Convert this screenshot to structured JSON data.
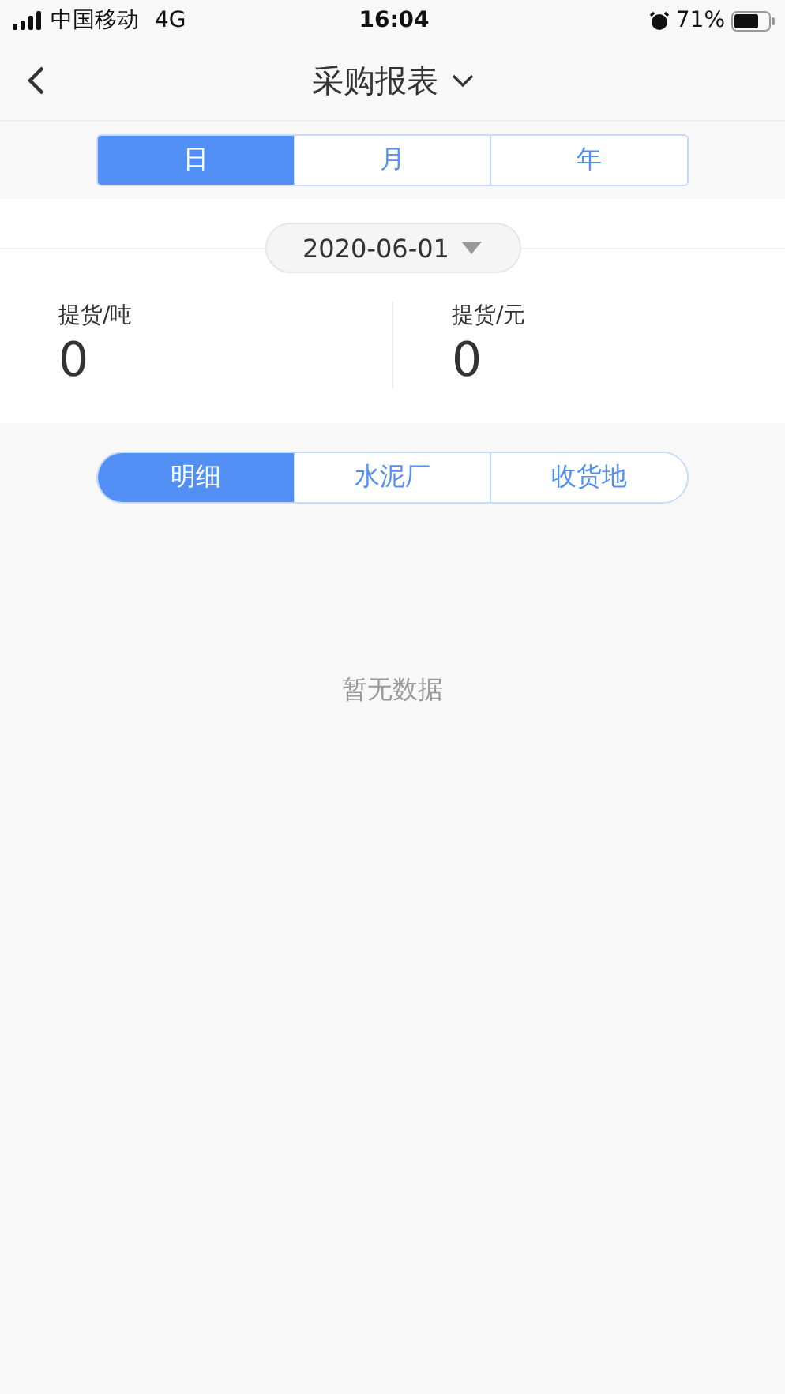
{
  "status_bar": {
    "carrier": "中国移动",
    "network": "4G",
    "time": "16:04",
    "battery": "71%"
  },
  "nav": {
    "title": "采购报表"
  },
  "period_tabs": [
    {
      "label": "日",
      "selected": true
    },
    {
      "label": "月",
      "selected": false
    },
    {
      "label": "年",
      "selected": false
    }
  ],
  "date_picker": {
    "value": "2020-06-01"
  },
  "stats": [
    {
      "label": "提货/吨",
      "value": "0"
    },
    {
      "label": "提货/元",
      "value": "0"
    }
  ],
  "view_tabs": [
    {
      "label": "明细",
      "selected": true
    },
    {
      "label": "水泥厂",
      "selected": false
    },
    {
      "label": "收货地",
      "selected": false
    }
  ],
  "empty_message": "暂无数据"
}
